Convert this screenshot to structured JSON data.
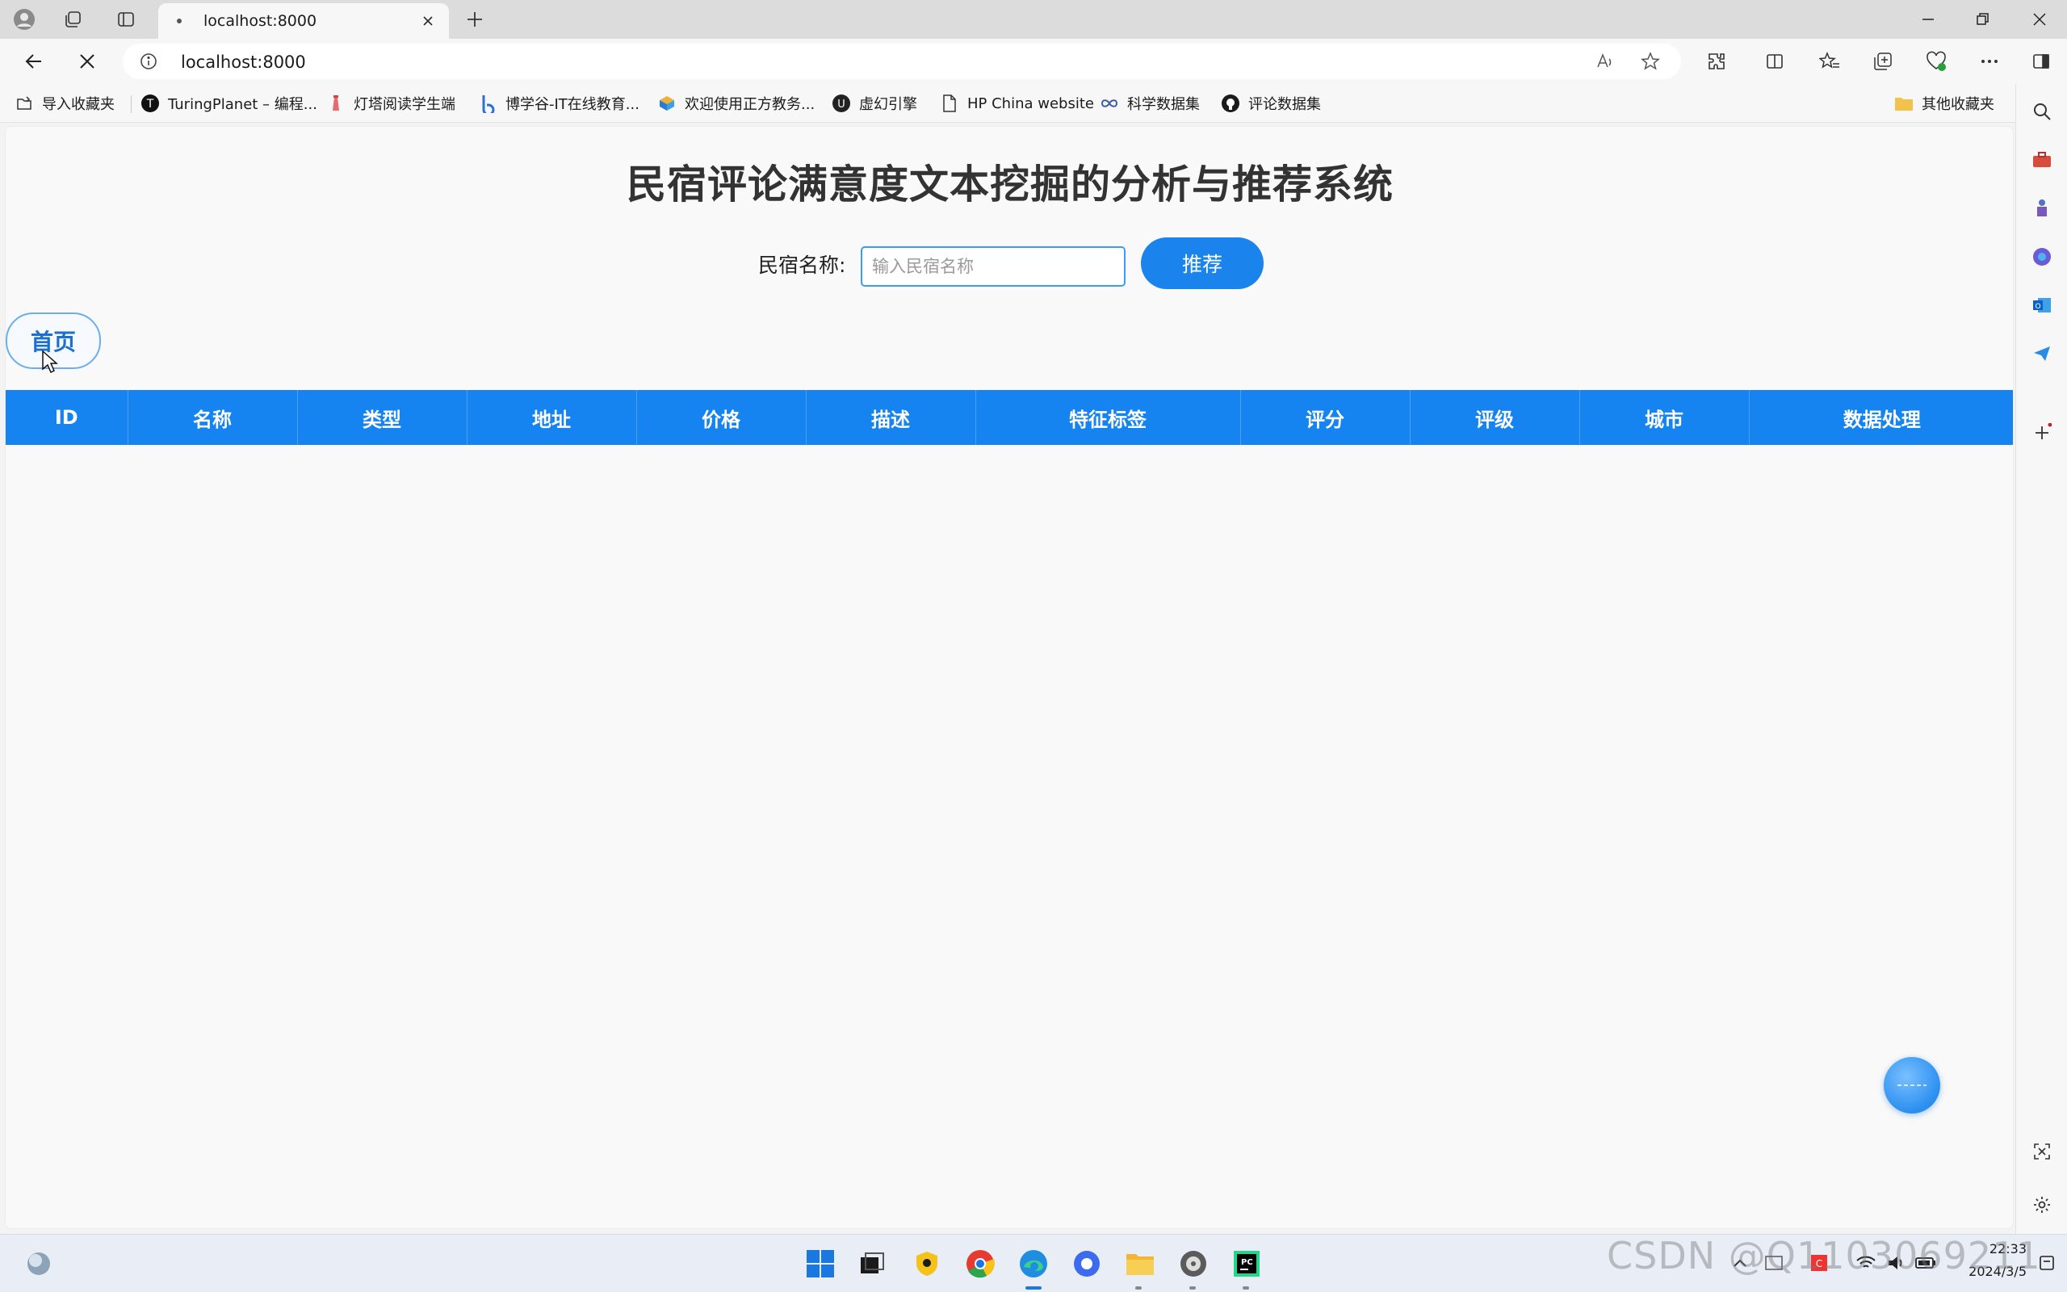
{
  "browser": {
    "tab": {
      "title": "localhost:8000"
    },
    "address": "localhost:8000",
    "bookmarks": [
      {
        "label": "导入收藏夹",
        "icon": "import-icon"
      },
      {
        "label": "TuringPlanet – 编程...",
        "icon": "turingplanet-icon"
      },
      {
        "label": "灯塔阅读学生端",
        "icon": "lighthouse-icon"
      },
      {
        "label": "博学谷-IT在线教育...",
        "icon": "boxuegu-icon"
      },
      {
        "label": "欢迎使用正方教务...",
        "icon": "zhengfang-icon"
      },
      {
        "label": "虚幻引擎",
        "icon": "unreal-icon"
      },
      {
        "label": "HP China website",
        "icon": "page-icon"
      },
      {
        "label": "科学数据集",
        "icon": "infinity-icon"
      },
      {
        "label": "评论数据集",
        "icon": "github-icon"
      }
    ],
    "other_bookmarks": "其他收藏夹"
  },
  "page": {
    "title": "民宿评论满意度文本挖掘的分析与推荐系统",
    "search": {
      "label": "民宿名称:",
      "placeholder": "输入民宿名称",
      "value": ""
    },
    "recommend_label": "推荐",
    "home_label": "首页",
    "table": {
      "columns": [
        "ID",
        "名称",
        "类型",
        "地址",
        "价格",
        "描述",
        "特征标签",
        "评分",
        "评级",
        "城市",
        "数据处理"
      ],
      "rows": []
    }
  },
  "taskbar": {
    "time": "22:33",
    "date": "2024/3/5"
  },
  "watermark": "CSDN @Q1103069211",
  "colors": {
    "accent": "#1583f0",
    "button": "#1a84ec"
  }
}
